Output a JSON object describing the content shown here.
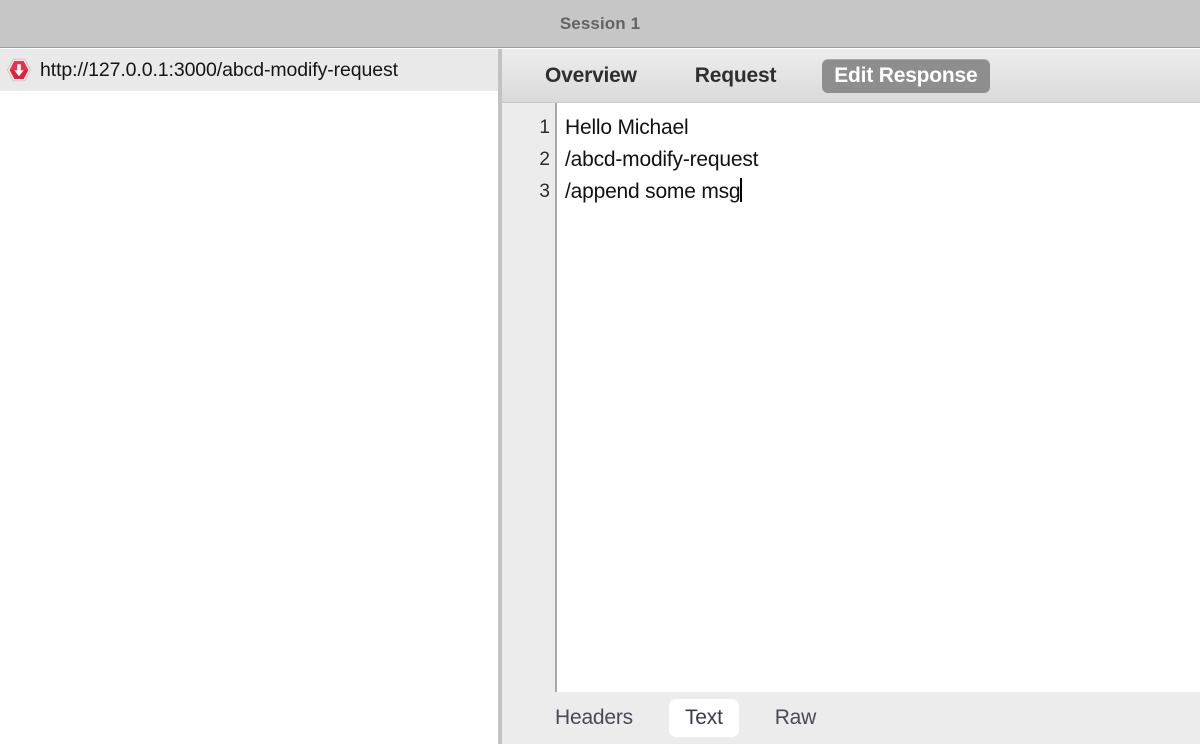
{
  "window": {
    "title": "Session 1"
  },
  "sessions": {
    "rows": [
      {
        "icon": "red-hexagon-down-arrow-icon",
        "url": "http://127.0.0.1:3000/abcd-modify-request"
      }
    ]
  },
  "detail": {
    "top_tabs": [
      {
        "label": "Overview",
        "selected": false
      },
      {
        "label": "Request",
        "selected": false
      },
      {
        "label": "Edit Response",
        "selected": true
      }
    ],
    "editor": {
      "line_numbers": [
        "1",
        "2",
        "3"
      ],
      "lines": [
        "Hello Michael",
        "/abcd-modify-request",
        "/append some msg"
      ],
      "caret_line": 3
    },
    "bottom_tabs": [
      {
        "label": "Headers",
        "selected": false
      },
      {
        "label": "Text",
        "selected": true
      },
      {
        "label": "Raw",
        "selected": false
      }
    ]
  },
  "colors": {
    "titlebar": "#c6c6c6",
    "titlebar_text": "#636363",
    "selected_tab_bg": "#8e8e8e",
    "selected_tab_text": "#ffffff",
    "icon_red": "#ec1b3a",
    "gutter_bg": "#ececec",
    "editor_bg": "#ffffff"
  }
}
